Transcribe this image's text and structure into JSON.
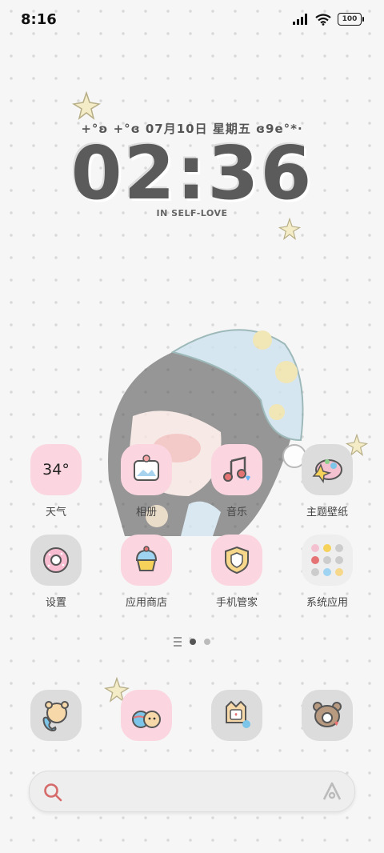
{
  "status_bar": {
    "time": "8:16",
    "battery": "100"
  },
  "clock_widget": {
    "date_line": "+°ʚ +°ɞ 07月10日  星期五 ɞ9e°*·",
    "time": "02:36",
    "slogan": "IN SELF-LOVE"
  },
  "apps": [
    {
      "label": "天气",
      "temp": "34°"
    },
    {
      "label": "相册"
    },
    {
      "label": "音乐"
    },
    {
      "label": "主题壁纸"
    },
    {
      "label": "设置"
    },
    {
      "label": "应用商店"
    },
    {
      "label": "手机管家"
    },
    {
      "label": "系统应用"
    }
  ],
  "page_indicator": {
    "pages": 2,
    "current": 1
  },
  "dock": [
    "phone",
    "browser",
    "messages",
    "camera"
  ],
  "colors": {
    "pink": "#fbd5e0",
    "grey": "#dcdcdc"
  }
}
